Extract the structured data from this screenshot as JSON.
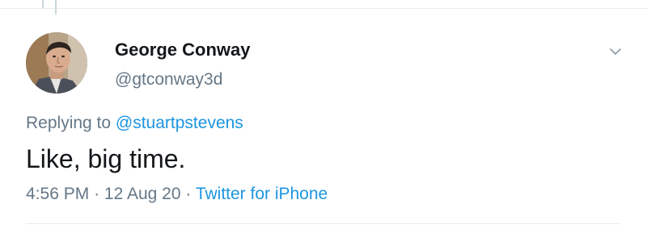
{
  "tweet": {
    "author": {
      "display_name": "George Conway",
      "handle": "@gtconway3d"
    },
    "reply": {
      "prefix": "Replying to",
      "mention": "@stuartpstevens"
    },
    "text": "Like, big time.",
    "meta": {
      "time": "4:56 PM",
      "separator": "·",
      "date": "12 Aug 20",
      "source": "Twitter for iPhone"
    },
    "menu_icon": "chevron-down-icon",
    "avatar_icon": "profile-photo"
  },
  "colors": {
    "text_primary": "#14171a",
    "text_secondary": "#657786",
    "link": "#1b95e0",
    "divider": "#e6ecf0"
  }
}
